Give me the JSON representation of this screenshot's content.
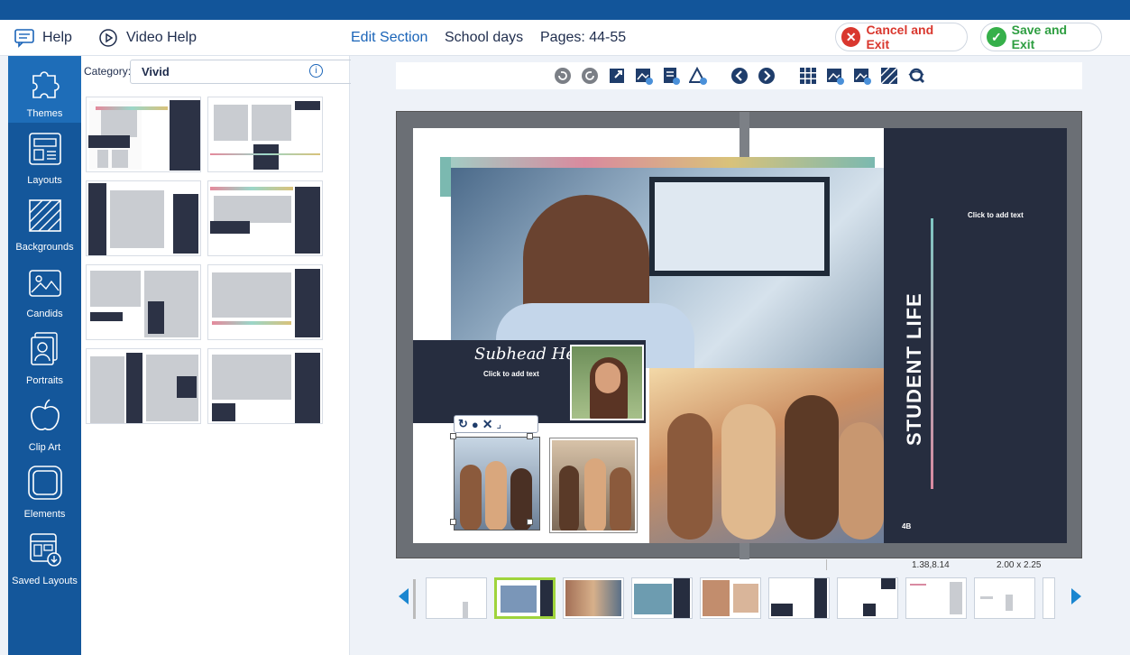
{
  "header": {
    "help": "Help",
    "video_help": "Video Help",
    "edit_section": "Edit Section",
    "section_name": "School days",
    "pages": "Pages: 44-55",
    "cancel": "Cancel and Exit",
    "save": "Save and Exit"
  },
  "sidebar": {
    "items": [
      {
        "label": "Themes",
        "icon": "puzzle-icon"
      },
      {
        "label": "Layouts",
        "icon": "layouts-icon"
      },
      {
        "label": "Backgrounds",
        "icon": "backgrounds-icon"
      },
      {
        "label": "Candids",
        "icon": "candids-icon"
      },
      {
        "label": "Portraits",
        "icon": "portraits-icon"
      },
      {
        "label": "Clip Art",
        "icon": "apple-icon"
      },
      {
        "label": "Elements",
        "icon": "elements-icon"
      },
      {
        "label": "Saved Layouts",
        "icon": "saved-layouts-icon"
      }
    ]
  },
  "panel": {
    "category_label": "Category:",
    "category_value": "Vivid"
  },
  "spread": {
    "subhead": "Subhead Here",
    "click_text_left": "Click to add text",
    "click_text_right": "Click to add text",
    "vertical_title": "STUDENT LIFE",
    "page_mark": "4B"
  },
  "status": {
    "position": "1.38,8.14",
    "size": "2.00 x 2.25"
  },
  "colors": {
    "brand": "#12559a",
    "accent": "#1a64b8",
    "danger": "#d9372e",
    "success": "#36b04a",
    "panel_dark": "#262d3f"
  }
}
